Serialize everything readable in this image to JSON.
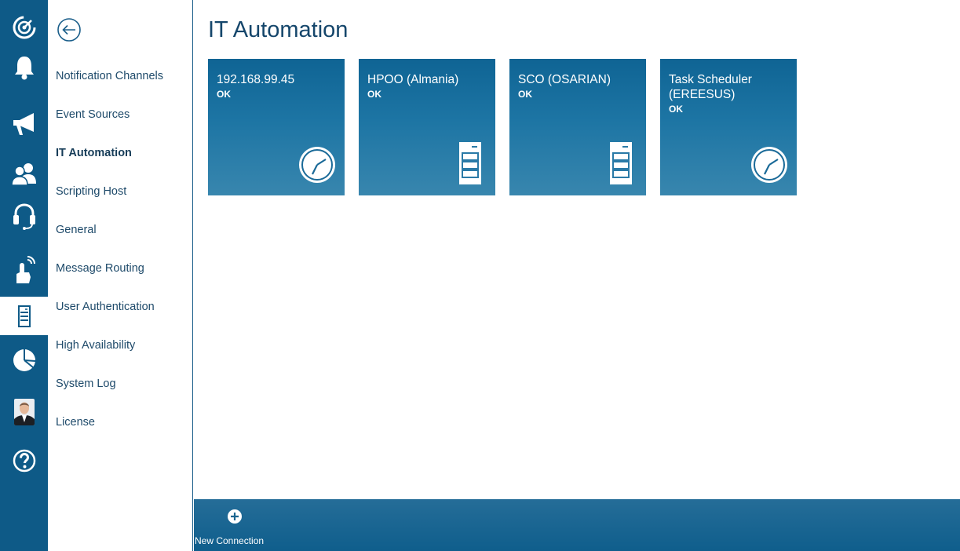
{
  "rail": {
    "items": [
      {
        "icon": "dashboard-icon"
      },
      {
        "icon": "bell-icon"
      },
      {
        "icon": "megaphone-icon"
      },
      {
        "icon": "users-icon"
      },
      {
        "icon": "headset-icon"
      },
      {
        "icon": "touch-icon"
      },
      {
        "icon": "server-icon",
        "active": true
      },
      {
        "icon": "pie-chart-icon"
      },
      {
        "icon": "avatar"
      },
      {
        "icon": "help-icon"
      }
    ]
  },
  "nav": {
    "items": [
      {
        "label": "Notification Channels"
      },
      {
        "label": "Event Sources"
      },
      {
        "label": "IT Automation",
        "active": true
      },
      {
        "label": "Scripting Host"
      },
      {
        "label": "General"
      },
      {
        "label": "Message Routing"
      },
      {
        "label": "User Authentication"
      },
      {
        "label": "High Availability"
      },
      {
        "label": "System Log"
      },
      {
        "label": "License"
      }
    ]
  },
  "page": {
    "title": "IT Automation"
  },
  "tiles": [
    {
      "name": "192.168.99.45",
      "status": "OK",
      "icon": "clock-icon"
    },
    {
      "name": "HPOO (Almania)",
      "status": "OK",
      "icon": "server-icon"
    },
    {
      "name": "SCO (OSARIAN)",
      "status": "OK",
      "icon": "server-icon"
    },
    {
      "name": "Task Scheduler (EREESUS)",
      "status": "OK",
      "icon": "clock-icon"
    }
  ],
  "toolbar": {
    "new_connection_label": "New Connection"
  },
  "colors": {
    "brand": "#0e5a87",
    "tile_top": "#0f6494",
    "tile_bottom": "#3886ae",
    "nav_text": "#1e4a6a"
  }
}
